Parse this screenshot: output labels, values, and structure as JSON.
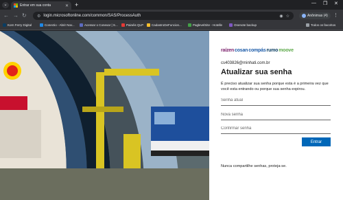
{
  "browser": {
    "tab_title": "Entrar em sua conta",
    "url": "login.microsoftonline.com/common/SAS/ProcessAuth",
    "profile_label": "Anônimas (4)",
    "bookmarks": [
      {
        "label": "Korn Ferry Digital",
        "color": "#0a3d62"
      },
      {
        "label": "Conectio - Abrir Nov...",
        "color": "#1e88e5"
      },
      {
        "label": "Acessar o Conexar | S...",
        "color": "#5c6bc0"
      },
      {
        "label": "Painéis QLP",
        "color": "#e53935"
      },
      {
        "label": "CadastroDeFuncion...",
        "color": "#fbc02d"
      },
      {
        "label": "PaglevelSite - Hotelle",
        "color": "#43a047"
      },
      {
        "label": "Onenote backup",
        "color": "#7e57c2"
      }
    ],
    "all_favorites_label": "Todos os favoritos"
  },
  "panel": {
    "brand": [
      {
        "text": "raízen",
        "color": "#7a1f6b"
      },
      {
        "text": "cosan",
        "color": "#1a5aa8"
      },
      {
        "text": "compás",
        "color": "#1a5aa8"
      },
      {
        "text": "rumo",
        "color": "#0a3d62"
      },
      {
        "text": "moove",
        "color": "#5da94a"
      }
    ],
    "email": "cs403826@minhati.com.br",
    "heading": "Atualizar sua senha",
    "description": "É preciso atualizar sua senha porque esta é a primeira vez que você esta entrando ou porque sua senha expirou.",
    "current_password_placeholder": "Senha atual",
    "new_password_placeholder": "Nova senha",
    "confirm_password_placeholder": "Confirmar senha",
    "submit_label": "Entrar",
    "footer_note": "Nunca compartilhe senhas, proteja-se."
  },
  "colors": {
    "accent": "#0067b8"
  }
}
